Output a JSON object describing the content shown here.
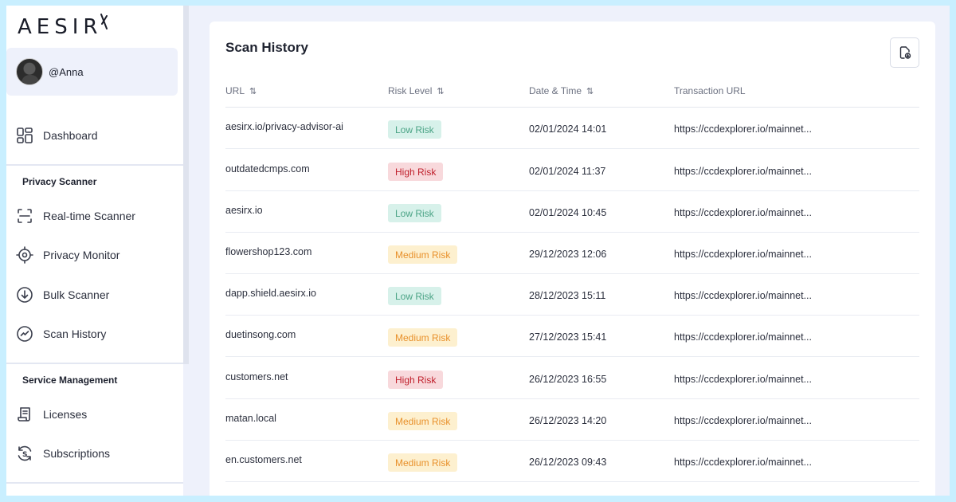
{
  "app": {
    "logo_text": "AESIR",
    "user": "@Anna"
  },
  "sidebar": {
    "dashboard": "Dashboard",
    "sections": {
      "privacy_scanner": "Privacy Scanner",
      "service_management": "Service Management"
    },
    "privacy_items": [
      {
        "label": "Real-time Scanner",
        "icon": "scan-icon"
      },
      {
        "label": "Privacy Monitor",
        "icon": "target-icon"
      },
      {
        "label": "Bulk Scanner",
        "icon": "download-circle-icon"
      },
      {
        "label": "Scan History",
        "icon": "history-icon"
      }
    ],
    "service_items": [
      {
        "label": "Licenses",
        "icon": "license-icon"
      },
      {
        "label": "Subscriptions",
        "icon": "subscription-icon"
      }
    ]
  },
  "main": {
    "title": "Scan History",
    "columns": [
      "URL",
      "Risk Level",
      "Date & Time",
      "Transaction URL"
    ],
    "rows": [
      {
        "url": "aesirx.io/privacy-advisor-ai",
        "risk": "Low Risk",
        "level": "low",
        "date": "02/01/2024 14:01",
        "tx": "https://ccdexplorer.io/mainnet..."
      },
      {
        "url": "outdatedcmps.com",
        "risk": "High Risk",
        "level": "high",
        "date": "02/01/2024 11:37",
        "tx": "https://ccdexplorer.io/mainnet..."
      },
      {
        "url": "aesirx.io",
        "risk": "Low Risk",
        "level": "low",
        "date": "02/01/2024 10:45",
        "tx": "https://ccdexplorer.io/mainnet..."
      },
      {
        "url": "flowershop123.com",
        "risk": "Medium Risk",
        "level": "medium",
        "date": "29/12/2023 12:06",
        "tx": "https://ccdexplorer.io/mainnet..."
      },
      {
        "url": "dapp.shield.aesirx.io",
        "risk": "Low Risk",
        "level": "low",
        "date": "28/12/2023 15:11",
        "tx": "https://ccdexplorer.io/mainnet..."
      },
      {
        "url": "duetinsong.com",
        "risk": "Medium Risk",
        "level": "medium",
        "date": "27/12/2023 15:41",
        "tx": "https://ccdexplorer.io/mainnet..."
      },
      {
        "url": "customers.net",
        "risk": "High Risk",
        "level": "high",
        "date": "26/12/2023 16:55",
        "tx": "https://ccdexplorer.io/mainnet..."
      },
      {
        "url": "matan.local",
        "risk": "Medium Risk",
        "level": "medium",
        "date": "26/12/2023 14:20",
        "tx": "https://ccdexplorer.io/mainnet..."
      },
      {
        "url": "en.customers.net",
        "risk": "Medium Risk",
        "level": "medium",
        "date": "26/12/2023 09:43",
        "tx": "https://ccdexplorer.io/mainnet..."
      }
    ]
  },
  "colors": {
    "low_bg": "#d7f1ea",
    "low_fg": "#4aa385",
    "high_bg": "#f8d9dc",
    "high_fg": "#c0202c",
    "medium_bg": "#fdf0cf",
    "medium_fg": "#e8902a"
  }
}
